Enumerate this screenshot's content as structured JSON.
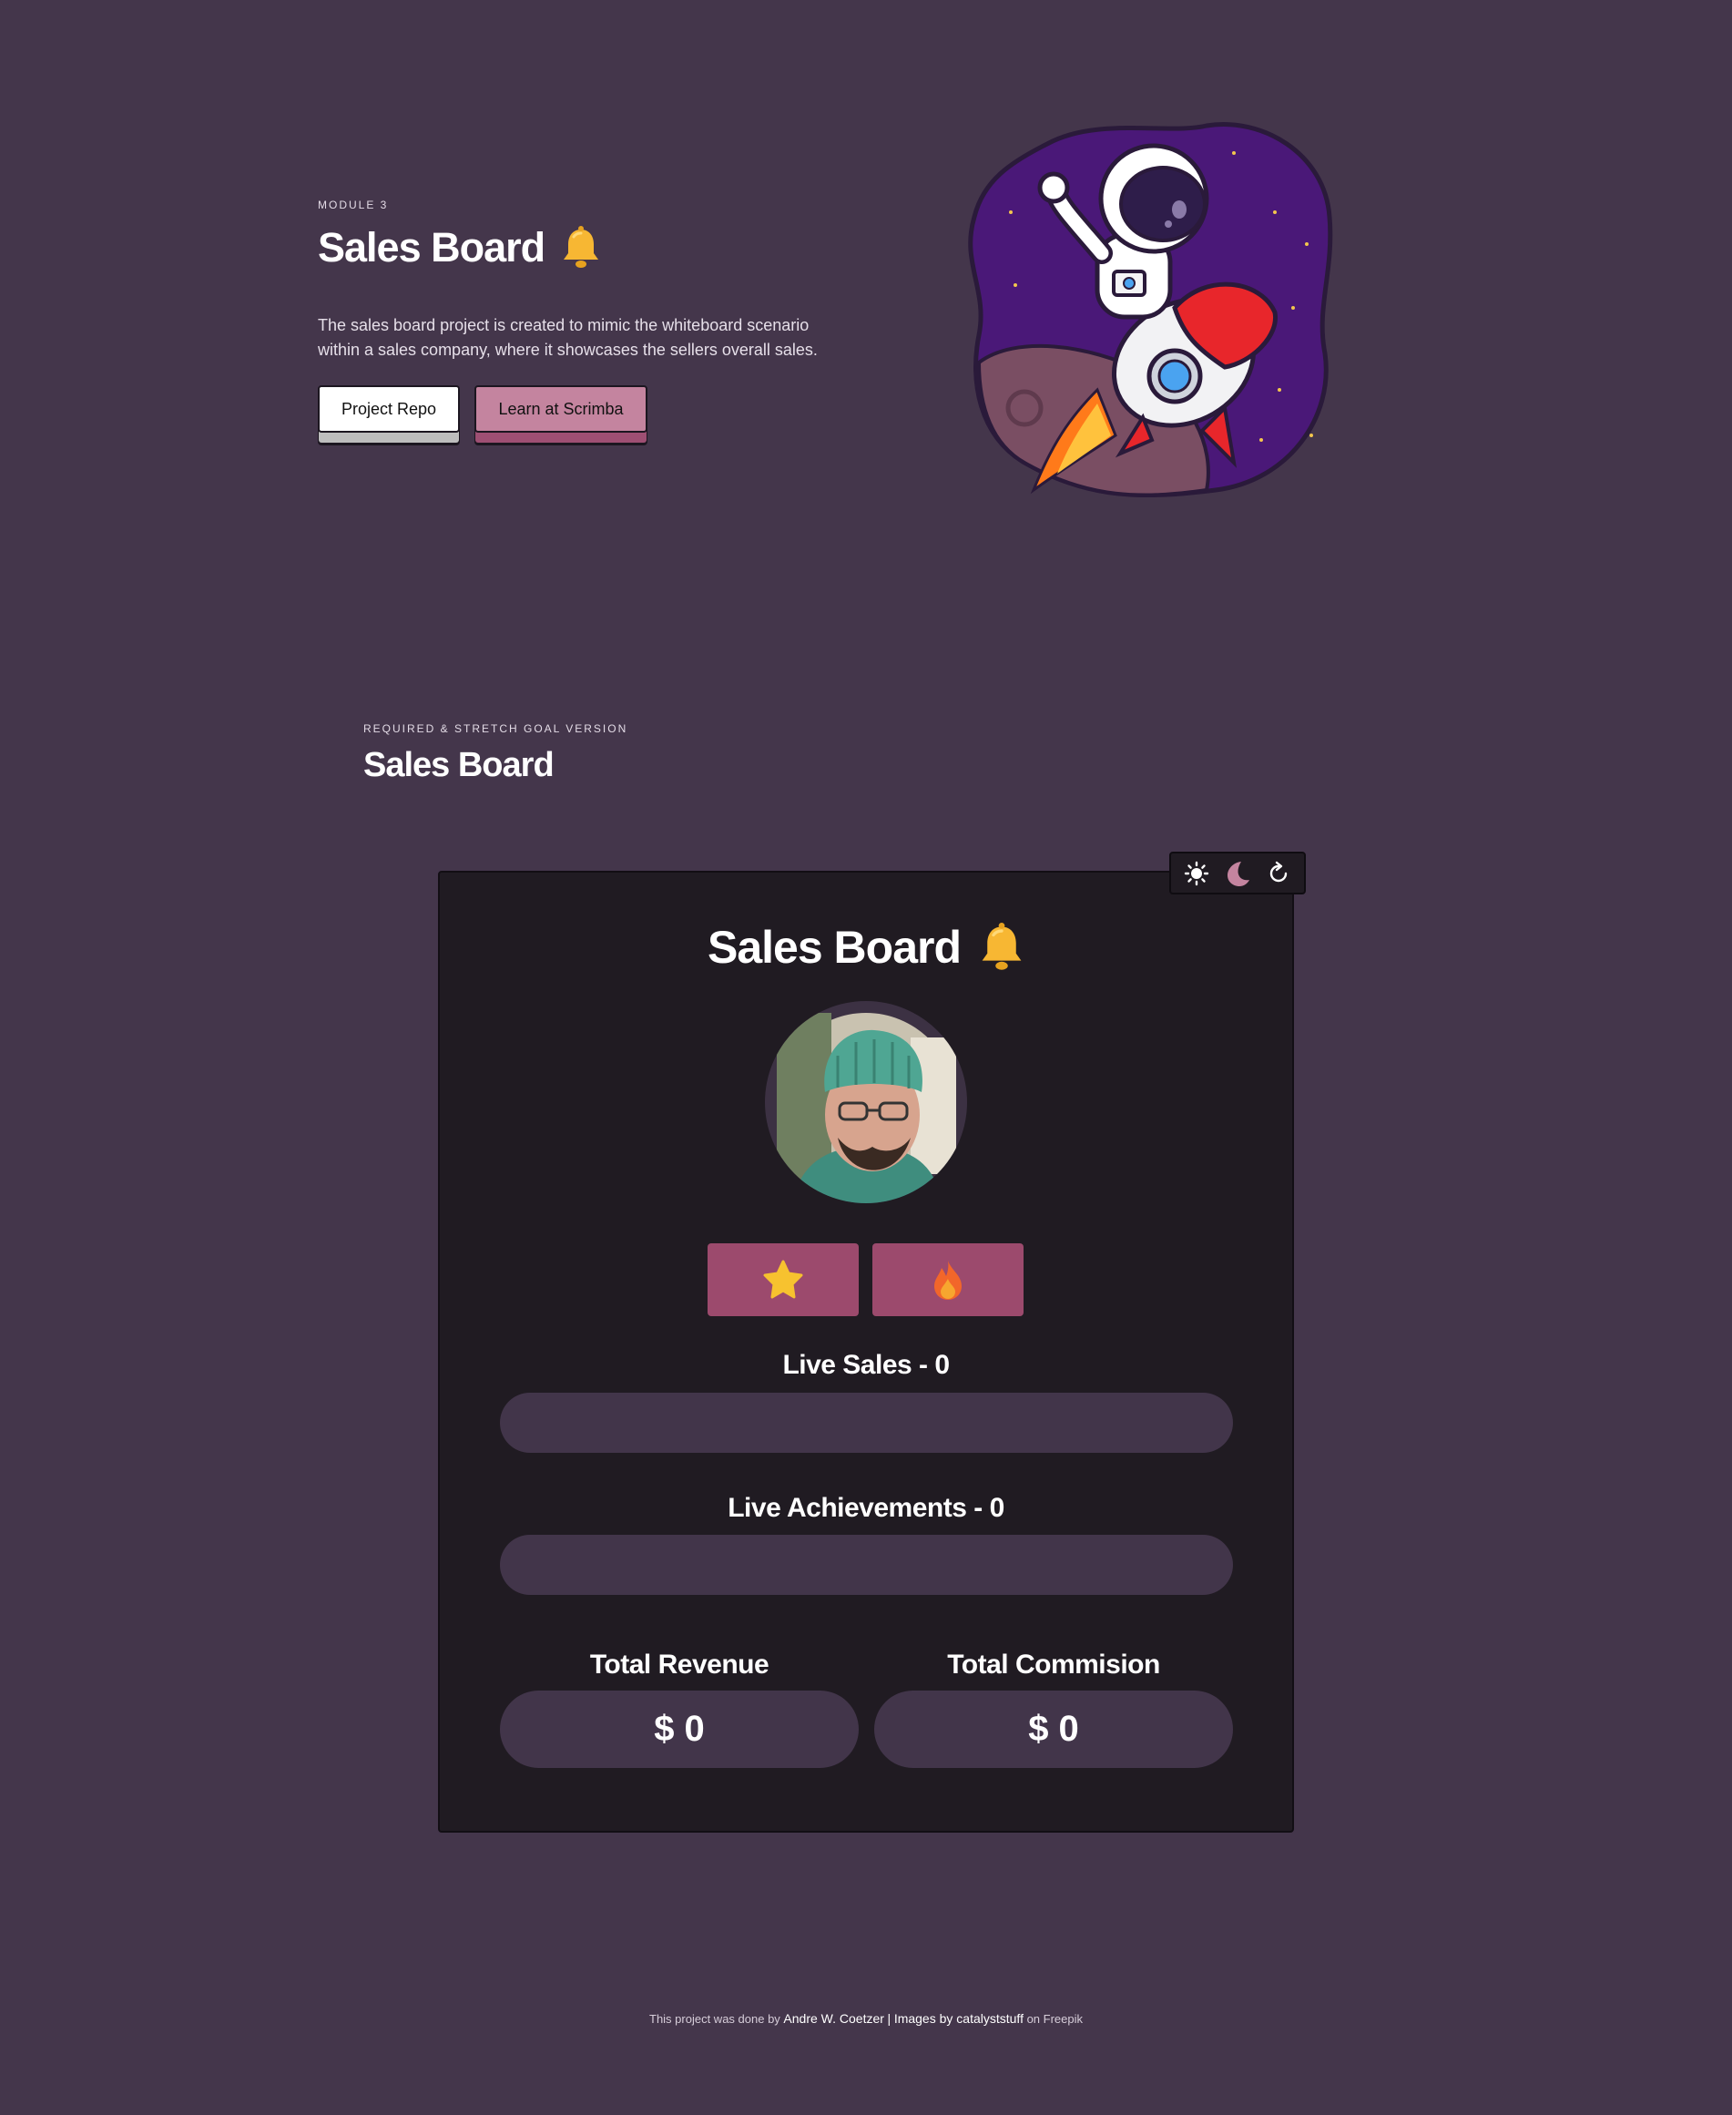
{
  "hero": {
    "eyebrow": "MODULE 3",
    "title": "Sales Board",
    "description": "The sales board project is created to mimic the whiteboard scenario within a sales company, where it showcases the sellers overall sales.",
    "buttons": {
      "repo": "Project Repo",
      "scrimba": "Learn at Scrimba"
    }
  },
  "section": {
    "eyebrow": "REQUIRED & STRETCH GOAL VERSION",
    "title": "Sales Board"
  },
  "board": {
    "title": "Sales Board",
    "toolbar": {
      "icons": [
        "sun-icon",
        "moon-icon",
        "refresh-icon"
      ]
    },
    "products": {
      "icons": [
        "star-icon",
        "fire-icon"
      ]
    },
    "live_sales": "Live Sales - 0",
    "live_achievements": "Live Achievements - 0",
    "total_revenue_label": "Total Revenue",
    "total_revenue_value": "$ 0",
    "total_commission_label": "Total Commision",
    "total_commission_value": "$ 0"
  },
  "footer": {
    "prefix": "This project was done by",
    "author": "Andre W. Coetzer",
    "separator": "|",
    "images_by": "Images by catalyststuff",
    "suffix": "on Freepik"
  },
  "colors": {
    "background": "#44364b",
    "card": "#201b22",
    "accent_pink": "#c4849f",
    "tile": "#9c4a6d",
    "bar": "#42354a"
  }
}
